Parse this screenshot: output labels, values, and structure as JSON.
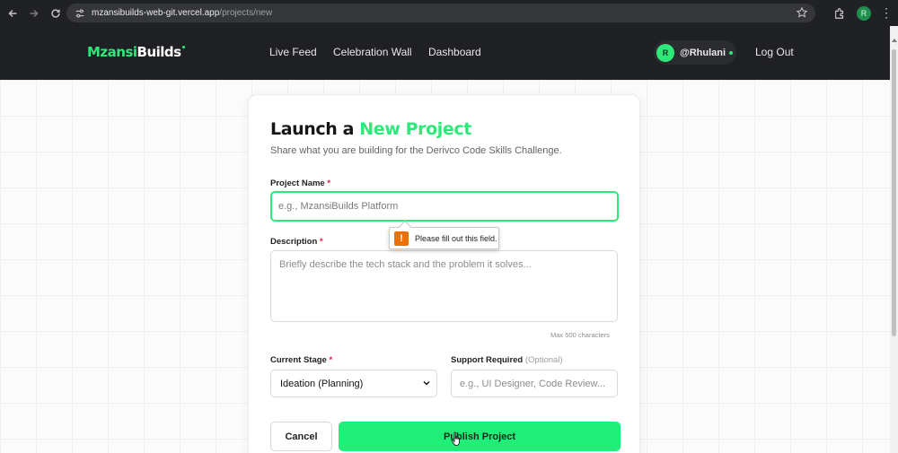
{
  "browser": {
    "url_host": "mzansibuilds-web-git.vercel.app",
    "url_path": "/projects/new",
    "profile_initial": "R",
    "icons": [
      "back-arrow-icon",
      "forward-arrow-icon",
      "reload-icon",
      "site-settings-icon",
      "bookmark-star-icon",
      "extensions-icon",
      "more-menu-icon"
    ]
  },
  "header": {
    "logo_primary": "Mzansi",
    "logo_secondary": "Builds",
    "logo_dot": "•",
    "nav": [
      "Live Feed",
      "Celebration Wall",
      "Dashboard"
    ],
    "user": {
      "avatar_initial": "R",
      "handle": "@Rhulani"
    },
    "logout_label": "Log Out"
  },
  "form": {
    "title_prefix": "Launch a ",
    "title_accent": "New Project",
    "subtitle": "Share what you are building for the Derivco Code Skills Challenge.",
    "project_name": {
      "label": "Project Name",
      "required_mark": "*",
      "value": "",
      "placeholder": "e.g., MzansiBuilds Platform"
    },
    "validation_tooltip": "Please fill out this field.",
    "description": {
      "label": "Description",
      "required_mark": "*",
      "value": "",
      "placeholder": "Briefly describe the tech stack and the problem it solves...",
      "hint": "Max 500 characters"
    },
    "current_stage": {
      "label": "Current Stage",
      "required_mark": "*",
      "selected": "Ideation (Planning)"
    },
    "support_required": {
      "label": "Support Required",
      "optional_note": "(Optional)",
      "value": "",
      "placeholder": "e.g., UI Designer, Code Review..."
    },
    "cancel_label": "Cancel",
    "publish_label": "Publish Project"
  },
  "colors": {
    "brand_green": "#2ee97a",
    "header_bg": "#1f2023",
    "required_red": "#e11d48",
    "warning_orange": "#e8710a"
  }
}
